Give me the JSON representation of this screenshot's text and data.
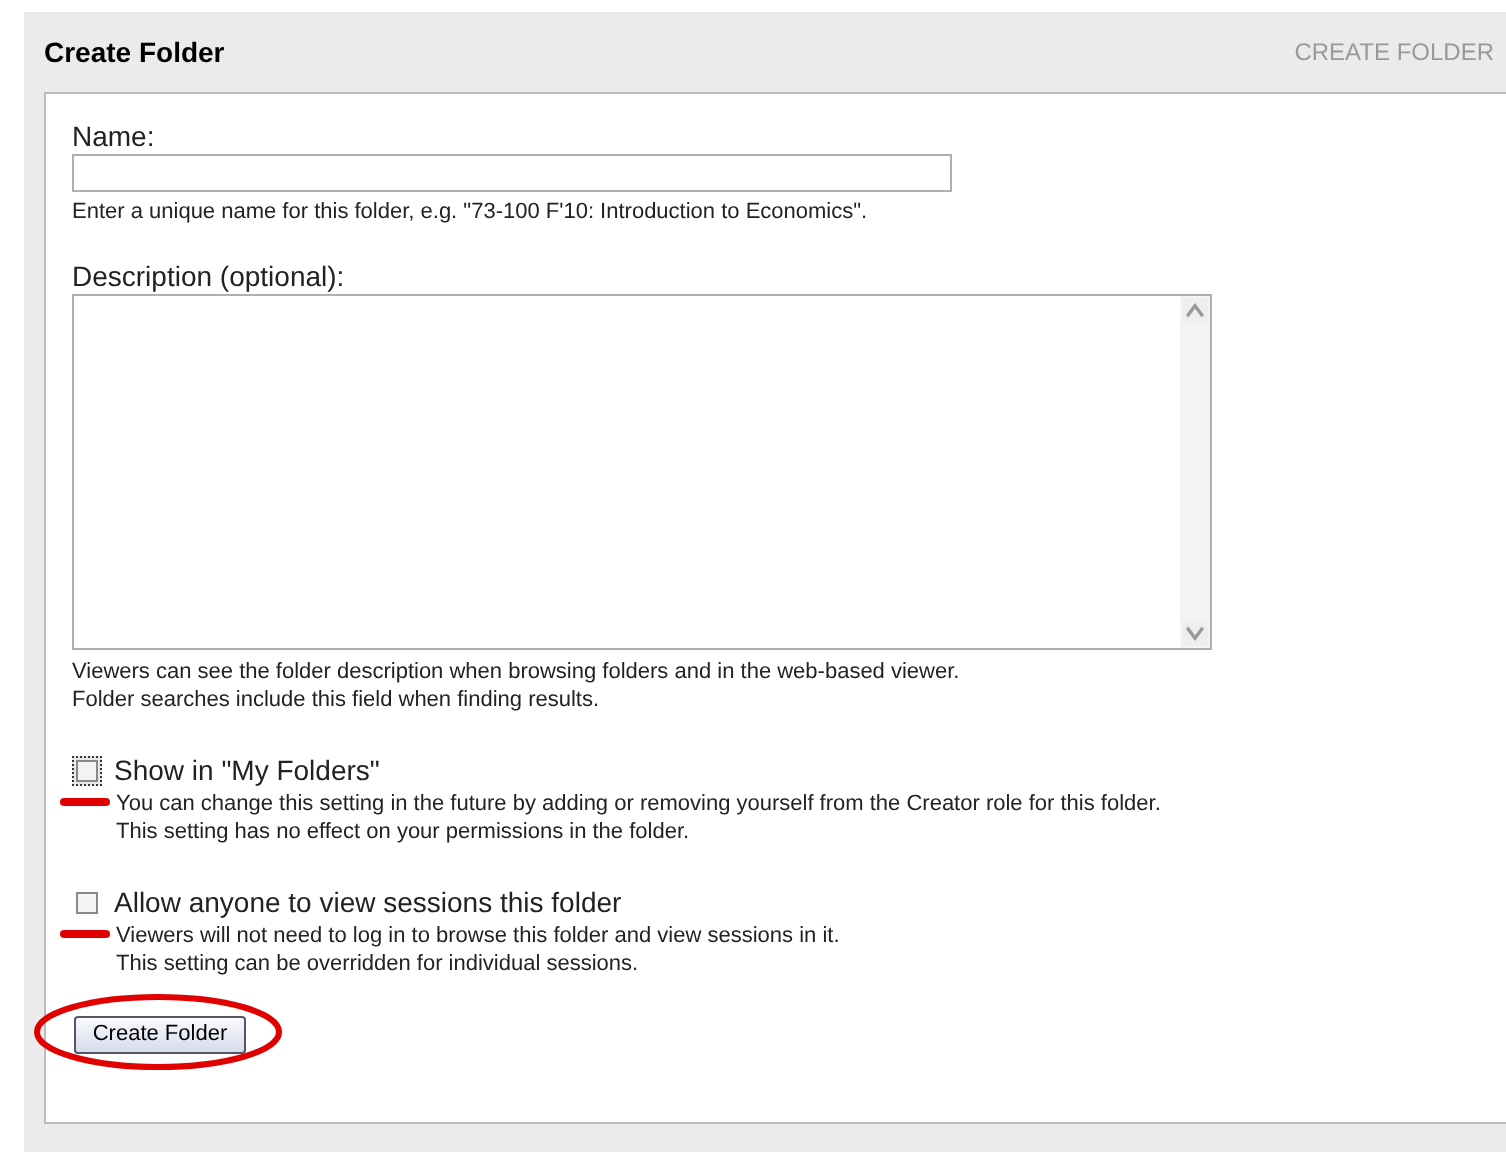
{
  "header": {
    "title": "Create Folder",
    "breadcrumb": "CREATE FOLDER"
  },
  "name_field": {
    "label": "Name:",
    "hint": "Enter a unique name for this folder, e.g. \"73-100 F'10: Introduction to Economics\"."
  },
  "description_field": {
    "label": "Description (optional):",
    "notes": [
      "Viewers can see the folder description when browsing folders and in the web-based viewer.",
      "Folder searches include this field when finding results."
    ]
  },
  "options": [
    {
      "label": "Show in \"My Folders\"",
      "checked": false,
      "focused": true,
      "notes": [
        "You can change this setting in the future by adding or removing yourself from the Creator role for this folder.",
        "This setting has no effect on your permissions in the folder."
      ]
    },
    {
      "label": "Allow anyone to view sessions this folder",
      "checked": false,
      "focused": false,
      "notes": [
        "Viewers will not need to log in to browse this folder and view sessions in it.",
        "This setting can be overridden for individual sessions."
      ]
    }
  ],
  "submit_button": "Create Folder"
}
